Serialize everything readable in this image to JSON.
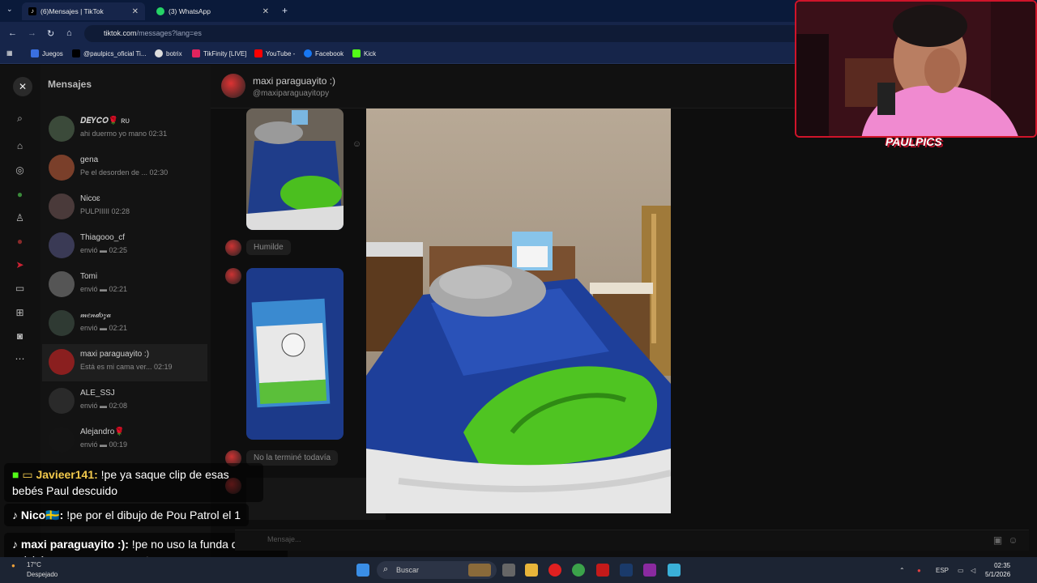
{
  "browser": {
    "tabs": [
      {
        "label": "(6)Mensajes | TikTok",
        "active": true
      },
      {
        "label": "(3) WhatsApp",
        "active": false
      }
    ],
    "url_host": "tiktok.com",
    "url_path": "/messages?lang=es",
    "bookmarks": [
      "Juegos",
      "@paulpics_oficial Ti...",
      "botrix",
      "TikFinity [LIVE]",
      "YouTube -",
      "Facebook",
      "Kick"
    ]
  },
  "inbox": {
    "title": "Mensajes",
    "conversations": [
      {
        "name": "𝑫𝑬𝒀𝑪𝑶🌹 ʀᴜ",
        "preview": "ahi duermo yo mano 02:31",
        "color": "#3b4a3a"
      },
      {
        "name": "gena",
        "preview": "Pe el desorden de ... 02:30",
        "color": "#7a3f2a"
      },
      {
        "name": "Nicoɛ",
        "preview": "PULPIIIII 02:28",
        "color": "#4a3a3a"
      },
      {
        "name": "Thiagooo_cf",
        "preview": "envió ▬ 02:25",
        "color": "#3a3a55"
      },
      {
        "name": "Tomi",
        "preview": "envió ▬ 02:21",
        "color": "#555555"
      },
      {
        "name": "𝓂𝑒𝓃𝒹𝑜𝓏𝒶",
        "preview": "envió ▬ 02:21",
        "color": "#2f3a33"
      },
      {
        "name": "maxi paraguayito :)",
        "preview": "Está es mi cama ver... 02:19",
        "color": "#8a1f1f"
      },
      {
        "name": "ALE_SSJ",
        "preview": "envió ▬ 02:08",
        "color": "#2a2a2a"
      },
      {
        "name": "Alejandro🌹",
        "preview": "envió ▬ 00:19",
        "color": "#141414"
      }
    ]
  },
  "chat": {
    "name": "maxi paraguayito :)",
    "handle": "@maxiparaguayitopy",
    "messages": [
      "Humilde",
      "No la terminé todavía"
    ],
    "input_placeholder": "Mensaje..."
  },
  "overlay": {
    "logo": "PAULPICS",
    "chat": [
      {
        "user": "Javieer141:",
        "text": " !pe ya saque clip de esas bebés Paul descuido"
      },
      {
        "user": "Nico🇸🇪:",
        "text": " !pe por el dibujo de Pou Patrol el 1"
      },
      {
        "user": "maxi paraguayito :):",
        "text": " !pe no uso la funda de colchón porque no me gusta"
      }
    ]
  },
  "taskbar": {
    "search": "Buscar",
    "weather_temp": "17°C",
    "weather_desc": "Despejado",
    "lang": "ESP",
    "time": "02:35",
    "date": "5/1/2026"
  },
  "colors": {
    "accent_red": "#d0142a",
    "tab_bg": "#0a1a3a",
    "toolbar_bg": "#16254a"
  }
}
